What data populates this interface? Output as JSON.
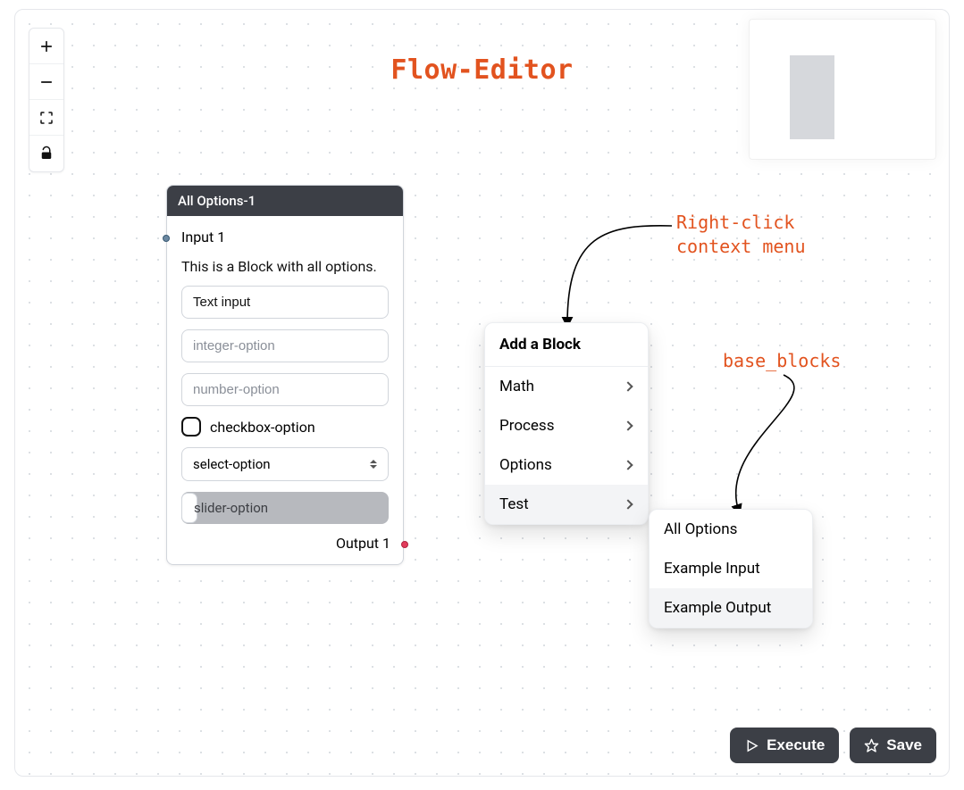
{
  "title": "Flow-Editor",
  "toolbar": {
    "zoom_in": "plus-icon",
    "zoom_out": "minus-icon",
    "fit": "fit-view-icon",
    "lock": "lock-icon"
  },
  "annotations": {
    "context_menu_line1": "Right-click",
    "context_menu_line2": "context menu",
    "base_blocks": "base_blocks"
  },
  "block": {
    "header": "All Options-1",
    "input_port_label": "Input 1",
    "output_port_label": "Output 1",
    "description": "This is a Block with all options.",
    "text_input_value": "Text input",
    "integer_placeholder": "integer-option",
    "number_placeholder": "number-option",
    "checkbox_label": "checkbox-option",
    "select_value": "select-option",
    "slider_label": "slider-option"
  },
  "context_menu": {
    "title": "Add a Block",
    "items": [
      {
        "label": "Math",
        "has_children": true,
        "hover": false
      },
      {
        "label": "Process",
        "has_children": true,
        "hover": false
      },
      {
        "label": "Options",
        "has_children": true,
        "hover": false
      },
      {
        "label": "Test",
        "has_children": true,
        "hover": true
      }
    ]
  },
  "submenu": {
    "items": [
      {
        "label": "All Options",
        "hover": false
      },
      {
        "label": "Example Input",
        "hover": false
      },
      {
        "label": "Example Output",
        "hover": true
      }
    ]
  },
  "footer": {
    "execute_label": "Execute",
    "save_label": "Save"
  }
}
